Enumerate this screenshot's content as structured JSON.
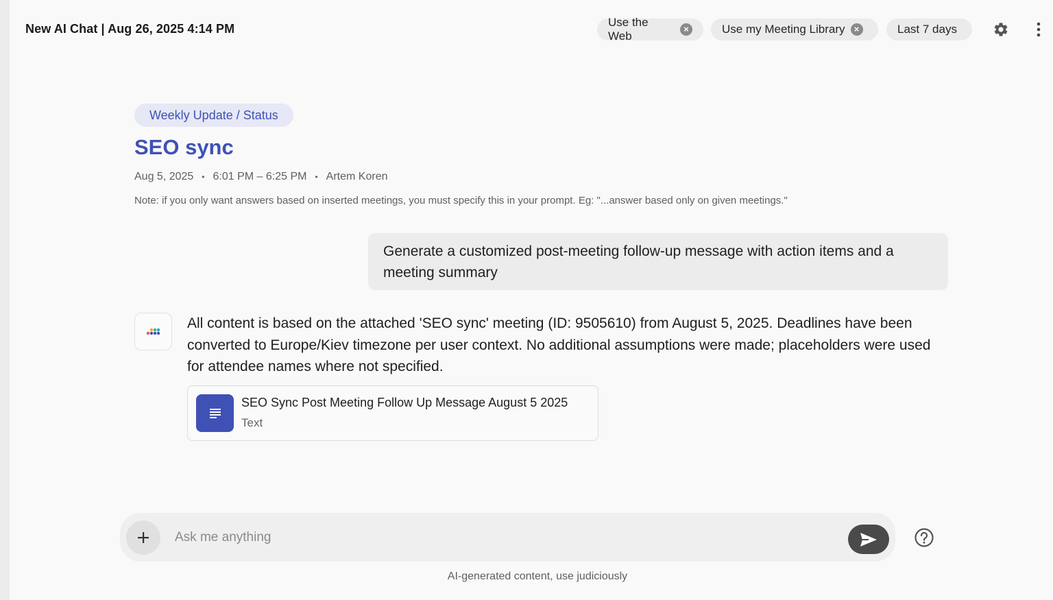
{
  "header": {
    "title": "New AI Chat | Aug 26, 2025 4:14 PM",
    "chips": [
      {
        "label": "Use the Web",
        "removable": true
      },
      {
        "label": "Use my Meeting Library",
        "removable": true
      },
      {
        "label": "Last 7 days",
        "removable": false
      }
    ],
    "settings_icon": "gear-icon",
    "more_icon": "kebab-menu-icon"
  },
  "meeting": {
    "tag": "Weekly Update / Status",
    "title": "SEO sync",
    "date": "Aug 5, 2025",
    "time": "6:01 PM – 6:25 PM",
    "host": "Artem Koren",
    "separator": "•",
    "note": "Note: if you only want answers based on inserted meetings, you must specify this in your prompt. Eg: \"...answer based only on given meetings.\""
  },
  "conversation": {
    "user_message": "Generate a customized post-meeting follow-up message with action items and a meeting summary",
    "ai_message": "All content is based on the attached 'SEO sync' meeting (ID: 9505610) from August 5, 2025. Deadlines have been converted to Europe/Kiev timezone per user context. No additional assumptions were made; placeholders were used for attendee names where not specified.",
    "attachment": {
      "title": "SEO Sync Post Meeting Follow Up Message August 5 2025",
      "type": "Text",
      "icon": "document-icon"
    }
  },
  "composer": {
    "placeholder": "Ask me anything",
    "value": "",
    "add_icon": "plus-icon",
    "send_icon": "send-icon",
    "help_icon": "help-circle-icon"
  },
  "footer": {
    "disclaimer": "AI-generated content, use judiciously"
  },
  "colors": {
    "accent": "#3f51b5",
    "background": "#f9f9f9",
    "bubble": "#ececec"
  }
}
